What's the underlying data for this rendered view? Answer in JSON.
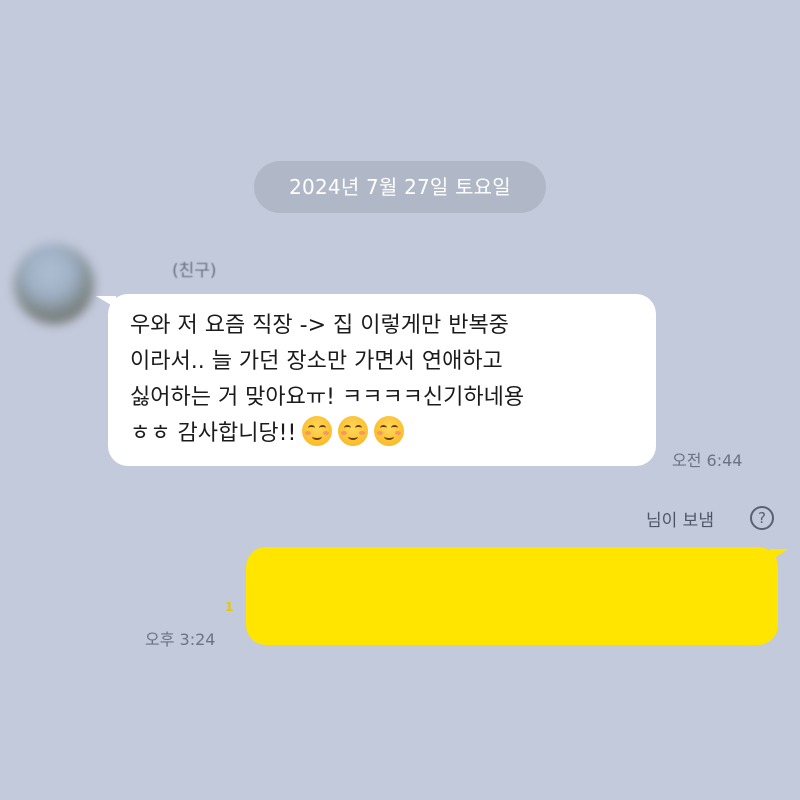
{
  "chat": {
    "date_divider": "2024년 7월 27일 토요일",
    "incoming": {
      "sender_name": "(친구)",
      "lines": [
        "우와  저 요즘 직장 -> 집 이렇게만 반복중",
        "이라서.. 늘 가던 장소만 가면서 연애하고",
        "싫어하는 거 맞아요ㅠ! ㅋㅋㅋㅋ신기하네용",
        "ㅎㅎ 감사합니당!!"
      ],
      "emoji": [
        "smiling-face-icon",
        "smiling-face-icon",
        "smiling-face-icon"
      ],
      "time": "오전 6:44"
    },
    "outgoing": {
      "sent_by_label": "님이 보냄",
      "help_icon": "?",
      "message_text": "",
      "read_marker": "1",
      "time": "오후 3:24"
    }
  },
  "colors": {
    "background": "#c3cadc",
    "incoming_bubble": "#ffffff",
    "outgoing_bubble": "#ffe500",
    "date_pill": "#b0b7c7"
  }
}
